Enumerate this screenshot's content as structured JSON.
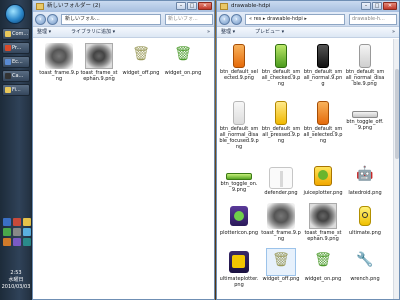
{
  "taskbar": {
    "items": [
      "Com...",
      "Pr...",
      "Ec...",
      "Ca...",
      "Fi..."
    ],
    "clock_time": "2:53",
    "clock_day": "水曜日",
    "clock_date": "2010/03/03"
  },
  "left_window": {
    "title": "新しいフォルダー (2)",
    "address": "新しいフォル...",
    "search_placeholder": "新しいフォ...",
    "toolbar": {
      "organize": "整理 ▾",
      "library": "ライブラリに追加 ▾",
      "more": "»"
    },
    "files": [
      {
        "name": "toast_frame.9.png"
      },
      {
        "name": "toast_frame_stephan.9.png"
      },
      {
        "name": "widget_off.png"
      },
      {
        "name": "widget_on.png"
      }
    ]
  },
  "right_window": {
    "title": "drawable-hdpi",
    "address": "« res ▸ drawable-hdpi ▸",
    "search_placeholder": "drawable-h...",
    "toolbar": {
      "organize": "整理 ▾",
      "preview": "プレビュー ▾",
      "more": "»"
    },
    "files": [
      {
        "name": "btn_default_selected.9.png"
      },
      {
        "name": "btn_default_small_checked.9.png"
      },
      {
        "name": "btn_default_small_normal.9.png"
      },
      {
        "name": "btn_default_small_normal_disable.9.png"
      },
      {
        "name": "btn_default_small_normal_disable_focused.9.png"
      },
      {
        "name": "btn_default_small_pressed.9.png"
      },
      {
        "name": "btn_default_small_selected.9.png"
      },
      {
        "name": "btn_toggle_off.9.png"
      },
      {
        "name": "btn_toggle_on.9.png"
      },
      {
        "name": "defender.png"
      },
      {
        "name": "juiceplotter.png"
      },
      {
        "name": "latedroid.png"
      },
      {
        "name": "plottericon.png"
      },
      {
        "name": "toast_frame.9.png"
      },
      {
        "name": "toast_frame_stephan.9.png"
      },
      {
        "name": "ultimate.png"
      },
      {
        "name": "ultimateplotter.png"
      },
      {
        "name": "widget_off.png"
      },
      {
        "name": "widget_on.png"
      },
      {
        "name": "wrench.png"
      }
    ]
  }
}
